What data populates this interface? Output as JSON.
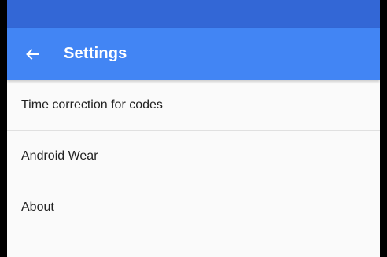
{
  "status_bar": {
    "color": "#3367d6"
  },
  "toolbar": {
    "title": "Settings",
    "back_icon": "arrow-back-icon",
    "color": "#4285f4"
  },
  "settings": {
    "items": [
      {
        "label": "Time correction for codes"
      },
      {
        "label": "Android Wear"
      },
      {
        "label": "About"
      }
    ]
  }
}
